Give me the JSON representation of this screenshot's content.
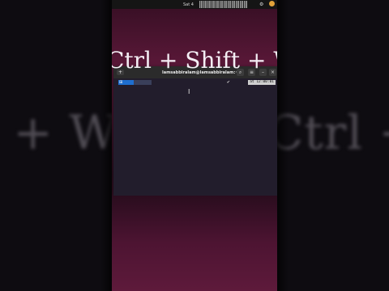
{
  "background": {
    "text": "Ctrl + Shift + W"
  },
  "topbar": {
    "clock": "Sat 4",
    "tray_icon": "gear-icon"
  },
  "terminal": {
    "title": "lamsabbiralam@lamsabbiralam:~",
    "new_tab_label": "+",
    "search_label": "⌕",
    "menu_label": "≡",
    "minimize_label": "–",
    "close_label": "×",
    "prompt_os_label": "",
    "prompt_status": "✔",
    "prompt_time": "at 12:00:01",
    "cursor": "I"
  },
  "overlay": {
    "shortcut": "Ctrl + Shift + W"
  },
  "colors": {
    "frame_top": "#4a1230",
    "frame_bottom": "#5b1638",
    "terminal_bg": "#241f30",
    "prompt_blue": "#1f6fd0"
  }
}
